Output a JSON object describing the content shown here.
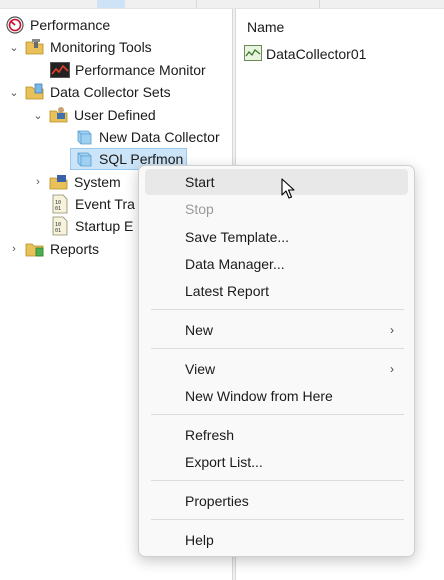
{
  "tree": {
    "root": "Performance",
    "monitoring_tools": "Monitoring Tools",
    "performance_monitor": "Performance Monitor",
    "data_collector_sets": "Data Collector Sets",
    "user_defined": "User Defined",
    "new_data_collector": "New Data Collector",
    "sql_perfmon": "SQL Perfmon",
    "system": "System",
    "event_trace": "Event Tra",
    "startup_event": "Startup E",
    "reports": "Reports"
  },
  "list": {
    "column_name": "Name",
    "items": [
      "DataCollector01"
    ]
  },
  "menu": {
    "start": "Start",
    "stop": "Stop",
    "save_template": "Save Template...",
    "data_manager": "Data Manager...",
    "latest_report": "Latest Report",
    "new": "New",
    "view": "View",
    "new_window": "New Window from Here",
    "refresh": "Refresh",
    "export_list": "Export List...",
    "properties": "Properties",
    "help": "Help"
  },
  "icons": {
    "chevron_down": "chevron-down-icon",
    "chevron_right": "chevron-right-icon",
    "submenu_arrow": "›"
  },
  "colors": {
    "selection": "#cce4f7",
    "selection_border": "#99c9ef",
    "menu_hover": "#e8e8e8"
  }
}
